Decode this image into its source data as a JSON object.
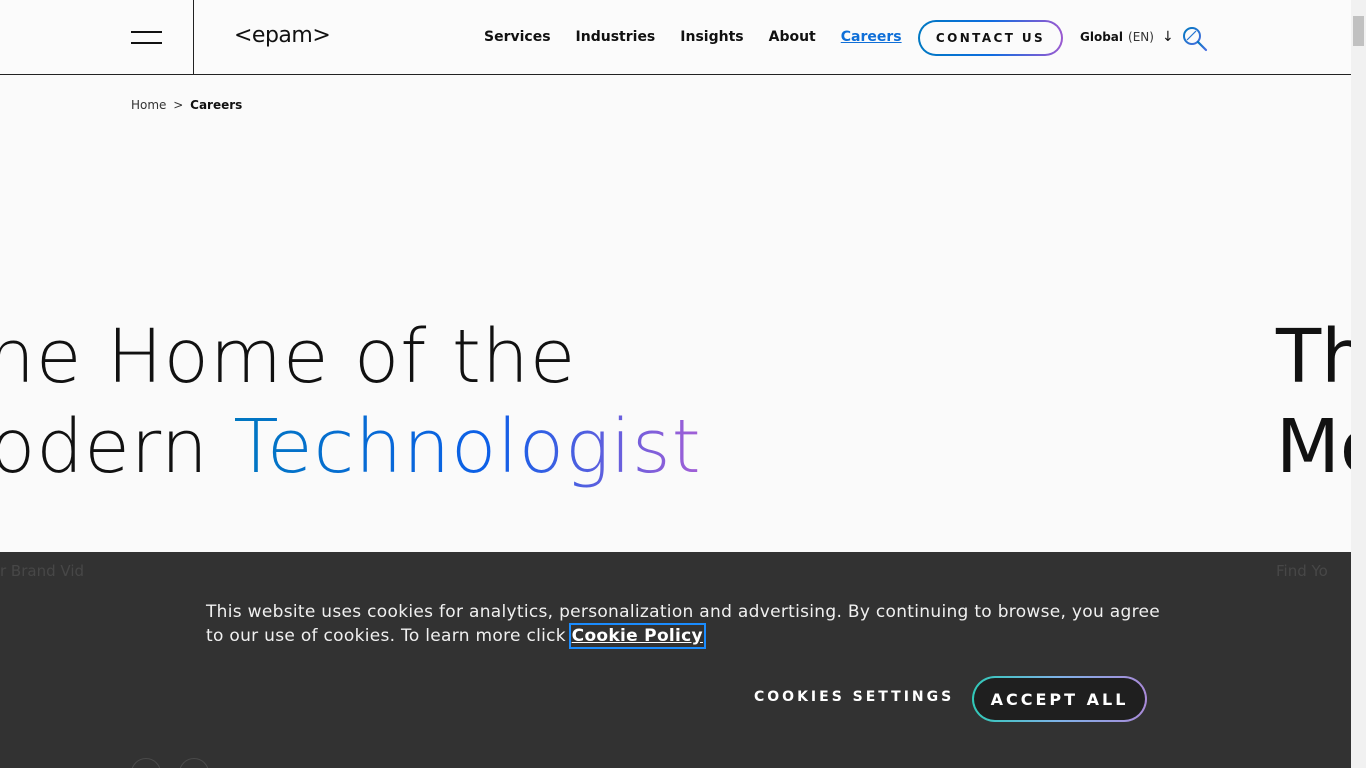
{
  "header": {
    "logo_text": "<epam>",
    "nav": [
      {
        "label": "Services"
      },
      {
        "label": "Industries"
      },
      {
        "label": "Insights"
      },
      {
        "label": "About"
      },
      {
        "label": "Careers",
        "active": true
      }
    ],
    "contact_label": "CONTACT US",
    "region_label": "Global",
    "language_label": "(EN)",
    "region_arrow": "↓"
  },
  "breadcrumb": {
    "home": "Home",
    "separator": ">",
    "current": "Careers"
  },
  "hero": {
    "line1": "he Home of the",
    "line2_prefix": "odern ",
    "line2_highlight": "Technologist",
    "next_line1": "Th",
    "next_line2": "Mo"
  },
  "cookie_banner": {
    "ghost_left": "r Brand Vid",
    "ghost_right": "Find Yo",
    "text": "This website uses cookies for analytics, personalization and advertising. By continuing to browse, you agree to our use of cookies. To learn more click ",
    "link": "Cookie Policy",
    "settings_label": "COOKIES SETTINGS",
    "accept_label": "ACCEPT ALL"
  },
  "colors": {
    "accent_blue": "#0f6fd8",
    "gradient_start": "#0077c0",
    "gradient_end": "#a35fd6",
    "banner_bg": "#323232"
  },
  "icons": {
    "menu": "hamburger-icon",
    "search": "search-icon",
    "dropdown": "arrow-down-icon"
  }
}
